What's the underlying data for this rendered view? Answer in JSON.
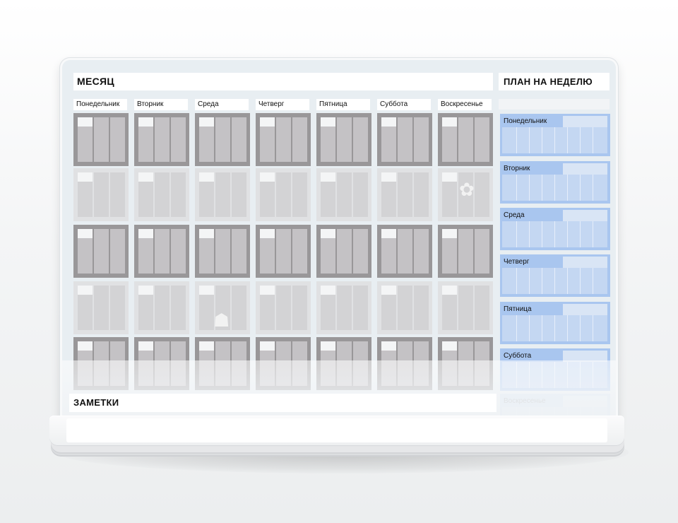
{
  "planner": {
    "month_title": "МЕСЯЦ",
    "week_title": "ПЛАН НА НЕДЕЛЮ",
    "notes_title": "ЗАМЕТКИ",
    "days": [
      "Понедельник",
      "Вторник",
      "Среда",
      "Четверг",
      "Пятница",
      "Суббота",
      "Воскресенье"
    ],
    "week_plan_days": [
      "Понедельник",
      "Вторник",
      "Среда",
      "Четверг",
      "Пятница",
      "Суббота",
      "Воскресенье"
    ]
  },
  "colors": {
    "week_plan_accent": "#a9c6ef",
    "dark_cells": "#999799",
    "light_cells": "#e0e1e3"
  },
  "icons": [
    "flower-pot-icon",
    "cat-icon"
  ]
}
